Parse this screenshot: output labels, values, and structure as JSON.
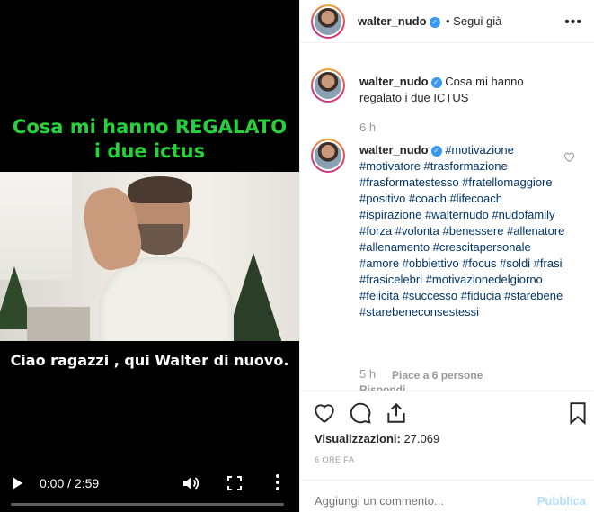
{
  "video": {
    "headline_line1": "Cosa mi hanno REGALATO",
    "headline_line2": "i due ictus",
    "subtitle": "Ciao ragazzi , qui Walter di nuovo.",
    "time": "0:00 / 2:59",
    "progress": 0,
    "icons": [
      "play-icon",
      "volume-icon",
      "fullscreen-icon",
      "more-options-icon"
    ]
  },
  "header": {
    "username": "walter_nudo",
    "follow_text": "• Segui già",
    "verified_glyph": "✓"
  },
  "caption": {
    "username": "walter_nudo",
    "text": "Cosa mi hanno regalato i due ICTUS",
    "time": "6 h"
  },
  "comment": {
    "username": "walter_nudo",
    "hashtags": "#motivazione #motivatore #trasformazione #frasformatestesso #fratellomaggiore #positivo #coach #lifecoach #ispirazione #walternudo #nudofamily #forza #volonta #benessere #allenatore #allenamento #crescitapersonale #amore #obbiettivo #focus #soldi #frasi #frasicelebri #motivazionedelgiorno #felicita #successo #fiducia #starebene #starebeneconsestessi",
    "time": "5 h",
    "likes": "Piace a 6 persone",
    "reply_partial": "Rispondi"
  },
  "stats": {
    "views_label": "Visualizzazioni:",
    "views_value": "27.069",
    "ago": "6 ORE FA"
  },
  "composer": {
    "placeholder": "Aggiungi un commento...",
    "publish": "Pubblica"
  },
  "colors": {
    "headline": "#27d13a",
    "hashtag": "#003569",
    "verified": "#3897f0",
    "publish_disabled": "#b2dffc"
  }
}
